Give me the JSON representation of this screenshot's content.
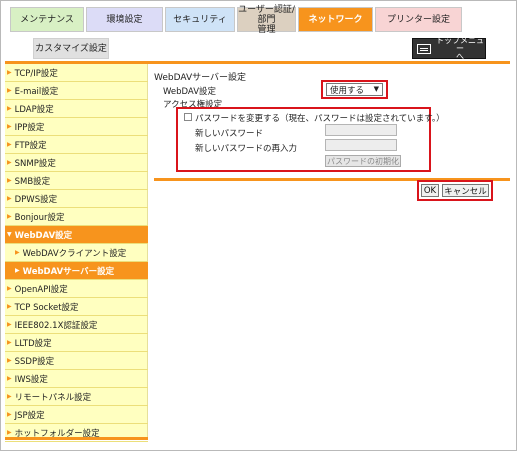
{
  "tabs": {
    "maintenance": "メンテナンス",
    "environment": "環境設定",
    "security": "セキュリティ",
    "user_auth_line1": "ユーザー認証/部門",
    "user_auth_line2": "管理",
    "network": "ネットワーク",
    "printer": "プリンター設定",
    "customize": "カスタマイズ設定"
  },
  "top_menu": {
    "line1": "トップメニュー",
    "line2": "へ",
    "icon": "menu-icon"
  },
  "sidebar": {
    "items": [
      {
        "label": "TCP/IP設定"
      },
      {
        "label": "E-mail設定"
      },
      {
        "label": "LDAP設定"
      },
      {
        "label": "IPP設定"
      },
      {
        "label": "FTP設定"
      },
      {
        "label": "SNMP設定"
      },
      {
        "label": "SMB設定"
      },
      {
        "label": "DPWS設定"
      },
      {
        "label": "Bonjour設定"
      },
      {
        "label": "WebDAV設定"
      },
      {
        "label": "WebDAVクライアント設定"
      },
      {
        "label": "WebDAVサーバー設定"
      },
      {
        "label": "OpenAPI設定"
      },
      {
        "label": "TCP Socket設定"
      },
      {
        "label": "IEEE802.1X認証設定"
      },
      {
        "label": "LLTD設定"
      },
      {
        "label": "SSDP設定"
      },
      {
        "label": "IWS設定"
      },
      {
        "label": "リモートパネル設定"
      },
      {
        "label": "JSP設定"
      },
      {
        "label": "ホットフォルダー設定"
      }
    ]
  },
  "main": {
    "title": "WebDAVサーバー設定",
    "webdav_label": "WebDAV設定",
    "webdav_value": "使用する",
    "access_label": "アクセス権設定",
    "change_password_label": "パスワードを変更する（現在、パスワードは設定されています。）",
    "new_password_label": "新しいパスワード",
    "reenter_password_label": "新しいパスワードの再入力",
    "reset_password_button": "パスワードの初期化",
    "ok_button": "OK",
    "cancel_button": "キャンセル"
  },
  "colors": {
    "accent": "#f7941d",
    "highlight": "#d9141b",
    "sidebar_bg": "#ffffc0"
  }
}
